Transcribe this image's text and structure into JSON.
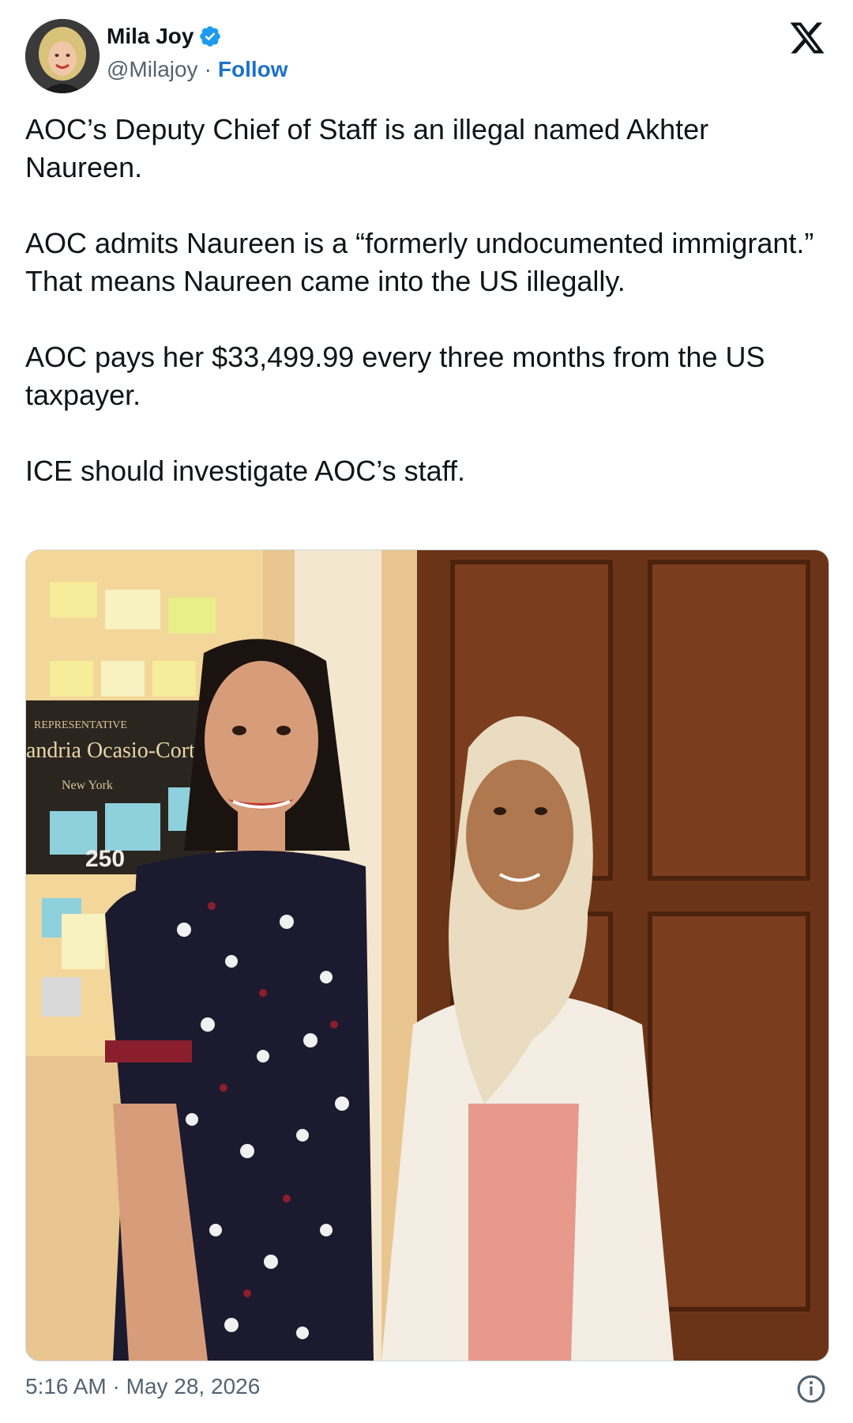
{
  "author": {
    "display_name": "Mila Joy",
    "handle": "@Milajoy",
    "separator": "·",
    "follow_label": "Follow",
    "verified": true,
    "verified_color": "#1d9bf0"
  },
  "tweet": {
    "paragraphs": [
      "AOC’s Deputy Chief of Staff is an illegal named Akhter Naureen.",
      "AOC admits Naureen is a “formerly undocumented immigrant.” That means Naureen came into the US illegally.",
      "AOC pays her $33,499.99 every three months from the US taxpayer.",
      "ICE should investigate AOC’s staff."
    ]
  },
  "photo": {
    "nameplate_line1": "REPRESENTATIVE",
    "nameplate_line2": "andria Ocasio-Corte",
    "nameplate_line3": "New York",
    "room_number": "250"
  },
  "footer": {
    "timestamp": "5:16 AM · May 28, 2026"
  },
  "icons": {
    "logo": "x-logo-icon",
    "verified": "verified-badge-icon",
    "info": "info-icon"
  },
  "colors": {
    "link": "#1d72c9",
    "secondary_text": "#536471",
    "primary_text": "#0f1419"
  }
}
